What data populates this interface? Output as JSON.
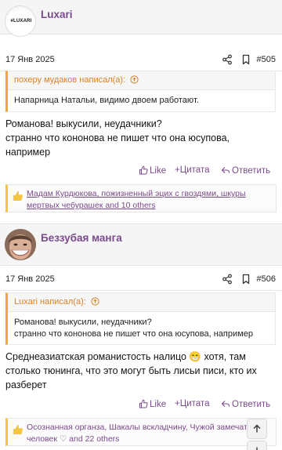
{
  "colors": {
    "accent": "#7b4a8c",
    "quote_accent": "#f0a83a",
    "like_accent": "#f4c542"
  },
  "posts": [
    {
      "username": "Luxari",
      "avatar_text": "#LUXARI",
      "date": "17 Янв 2025",
      "number": "#505",
      "quote": {
        "author": "похеру мудаков написал(а):",
        "lines": [
          "Напарница Натальи, видимо двоем работают."
        ]
      },
      "message": [
        "Романова! выкусили, неудачники?",
        "странно что кононова не пишет что она юсупова,",
        "например"
      ],
      "actions": {
        "like": "Like",
        "quote": "Цитата",
        "reply": "Ответить"
      },
      "likes": {
        "line1": "Мадам Курдюкова, пожизненный эцих с гвоздями, шкуры",
        "line2": "мертвых чебурашек and 10 others"
      }
    },
    {
      "username": "Беззубая манга",
      "date": "17 Янв 2025",
      "number": "#506",
      "quote": {
        "author": "Luxari написал(а):",
        "lines": [
          "Романова! выкусили, неудачники?",
          "странно что кононова не пишет что она юсупова, например"
        ]
      },
      "message": [
        "Среднеазиатская романистость налицо 😁 хотя, там",
        "столько тюнинга, что это могут быть лисьи писи, кто их",
        "разберет"
      ],
      "actions": {
        "like": "Like",
        "quote": "Цитата",
        "reply": "Ответить"
      },
      "likes": {
        "line1": "Осознанная органза, Шакалы вскладчину, Чужой замечател",
        "line2": "человек ♡ and 22 others"
      }
    }
  ],
  "icons": {
    "share": "share-icon",
    "bookmark": "bookmark-icon",
    "thumbs_up": "thumbs-up-icon",
    "scroll_up": "arrow-up-icon",
    "scroll_down": "arrow-down-icon"
  }
}
